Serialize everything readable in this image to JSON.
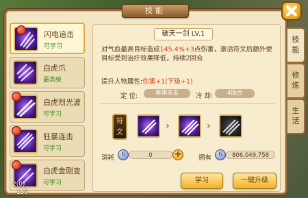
{
  "window": {
    "title": "技能"
  },
  "skills": [
    {
      "name": "闪电追击",
      "status": "可学习",
      "selected": true,
      "has_dot": true,
      "badge": "1"
    },
    {
      "name": "白虎爪",
      "status": "最高级",
      "selected": false,
      "has_dot": false
    },
    {
      "name": "白虎烈光波",
      "status": "可学习",
      "selected": false,
      "has_dot": true
    },
    {
      "name": "狂暴连击",
      "status": "可学习",
      "selected": false,
      "has_dot": true
    },
    {
      "name": "白虎金刚变",
      "status": "可学习",
      "selected": false,
      "has_dot": true
    }
  ],
  "corner_numbers": {
    "a": "2(0)",
    "b": "159"
  },
  "detail": {
    "title": "破天一剑 LV.1",
    "desc_pre": "对气血最高目标造成",
    "desc_value": "145.4%+3",
    "desc_post": "点伤害，激活符文后额外使目标受到治疗效果降低，持续2回合",
    "attr_label": "提升人物属性:",
    "attr_value": "伤害+1(下级+1)",
    "position_label": "定 位:",
    "position_value": "单体攻击",
    "cooldown_label": "冷 却:",
    "cooldown_value": "4回合",
    "rune_label": "符文",
    "cost_label": "消耗",
    "cost_value": "0",
    "own_label": "拥有",
    "own_value": "806,049,758",
    "learn_button": "学习",
    "upgrade_button": "一键升级"
  },
  "tabs": [
    {
      "label": "技能",
      "active": true
    },
    {
      "label": "修炼",
      "active": false
    },
    {
      "label": "生活",
      "active": false
    }
  ],
  "colors": {
    "highlight": "#d4401a",
    "status_green": "#3a8a1a",
    "frame": "#9b6a3a"
  }
}
